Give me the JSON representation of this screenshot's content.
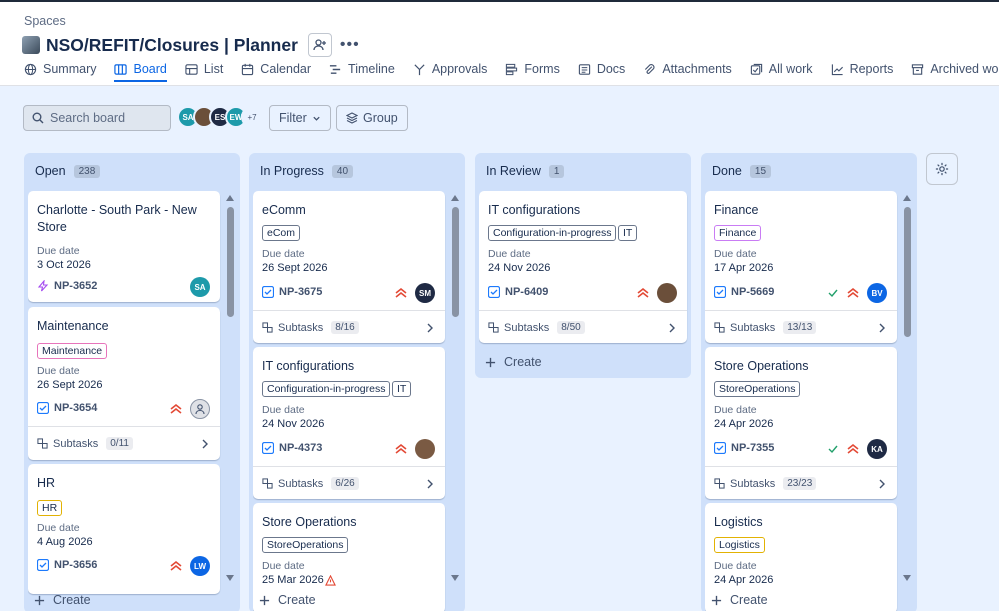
{
  "header": {
    "breadcrumb": "Spaces",
    "title": "NSO/REFIT/Closures | Planner",
    "tabs": [
      {
        "label": "Summary",
        "icon": "globe-icon"
      },
      {
        "label": "Board",
        "icon": "board-icon"
      },
      {
        "label": "List",
        "icon": "list-icon"
      },
      {
        "label": "Calendar",
        "icon": "calendar-icon"
      },
      {
        "label": "Timeline",
        "icon": "timeline-icon"
      },
      {
        "label": "Approvals",
        "icon": "approvals-icon"
      },
      {
        "label": "Forms",
        "icon": "forms-icon"
      },
      {
        "label": "Docs",
        "icon": "docs-icon"
      },
      {
        "label": "Attachments",
        "icon": "attachment-icon"
      },
      {
        "label": "All work",
        "icon": "all-work-icon"
      },
      {
        "label": "Reports",
        "icon": "reports-icon"
      },
      {
        "label": "Archived wor",
        "icon": "archive-icon"
      }
    ]
  },
  "toolbar": {
    "search_placeholder": "Search board",
    "avatars": [
      {
        "initials": "SA",
        "color": "#1d9aaa"
      },
      {
        "initials": "",
        "color": "#6b4f3a"
      },
      {
        "initials": "ES",
        "color": "#1f2a44"
      },
      {
        "initials": "EW",
        "color": "#1d9aaa"
      }
    ],
    "avatar_more": "+7",
    "filter_label": "Filter",
    "group_label": "Group"
  },
  "columns": [
    {
      "name": "Open",
      "count": "238",
      "cards": [
        {
          "title": "Charlotte - South Park - New Store",
          "due_label": "Due date",
          "due": "3 Oct 2026",
          "key": "NP-3652",
          "assignee": "SA",
          "assignee_color": "#1d9aaa"
        },
        {
          "title": "Maintenance",
          "label": "Maintenance",
          "due_label": "Due date",
          "due": "26 Sept 2026",
          "key": "NP-3654",
          "subtasks_label": "Subtasks",
          "subtasks": "0/11"
        },
        {
          "title": "HR",
          "label": "HR",
          "due_label": "Due date",
          "due": "4 Aug 2026",
          "key": "NP-3656",
          "assignee": "LW",
          "assignee_color": "#0c66e4"
        }
      ],
      "create": "Create"
    },
    {
      "name": "In Progress",
      "count": "40",
      "cards": [
        {
          "title": "eComm",
          "label": "eCom",
          "due_label": "Due date",
          "due": "26 Sept 2026",
          "key": "NP-3675",
          "assignee": "SM",
          "assignee_color": "#1f2a44",
          "subtasks_label": "Subtasks",
          "subtasks": "8/16"
        },
        {
          "title": "IT configurations",
          "label": "Configuration-in-progress",
          "label2": "IT",
          "due_label": "Due date",
          "due": "24 Nov 2026",
          "key": "NP-4373",
          "subtasks_label": "Subtasks",
          "subtasks": "6/26"
        },
        {
          "title": "Store Operations",
          "label": "StoreOperations",
          "due_label": "Due date",
          "due": "25 Mar 2026"
        }
      ],
      "create": "Create"
    },
    {
      "name": "In Review",
      "count": "1",
      "cards": [
        {
          "title": "IT configurations",
          "label": "Configuration-in-progress",
          "label2": "IT",
          "due_label": "Due date",
          "due": "24 Nov 2026",
          "key": "NP-6409",
          "subtasks_label": "Subtasks",
          "subtasks": "8/50"
        }
      ],
      "create": "Create"
    },
    {
      "name": "Done",
      "count": "15",
      "cards": [
        {
          "title": "Finance",
          "label": "Finance",
          "due_label": "Due date",
          "due": "17 Apr 2026",
          "key": "NP-5669",
          "assignee": "BV",
          "assignee_color": "#0c66e4",
          "subtasks_label": "Subtasks",
          "subtasks": "13/13"
        },
        {
          "title": "Store Operations",
          "label": "StoreOperations",
          "due_label": "Due date",
          "due": "24 Apr 2026",
          "key": "NP-7355",
          "assignee": "KA",
          "assignee_color": "#1f2a44",
          "subtasks_label": "Subtasks",
          "subtasks": "23/23"
        },
        {
          "title": "Logistics",
          "label": "Logistics",
          "due_label": "Due date",
          "due": "24 Apr 2026"
        }
      ],
      "create": "Create"
    }
  ],
  "colors": {
    "accent": "#0c66e4",
    "priority": "#e34935",
    "done_check": "#22a06b",
    "column_bg": "#cfe0fa",
    "board_bg": "#e9f2ff"
  }
}
